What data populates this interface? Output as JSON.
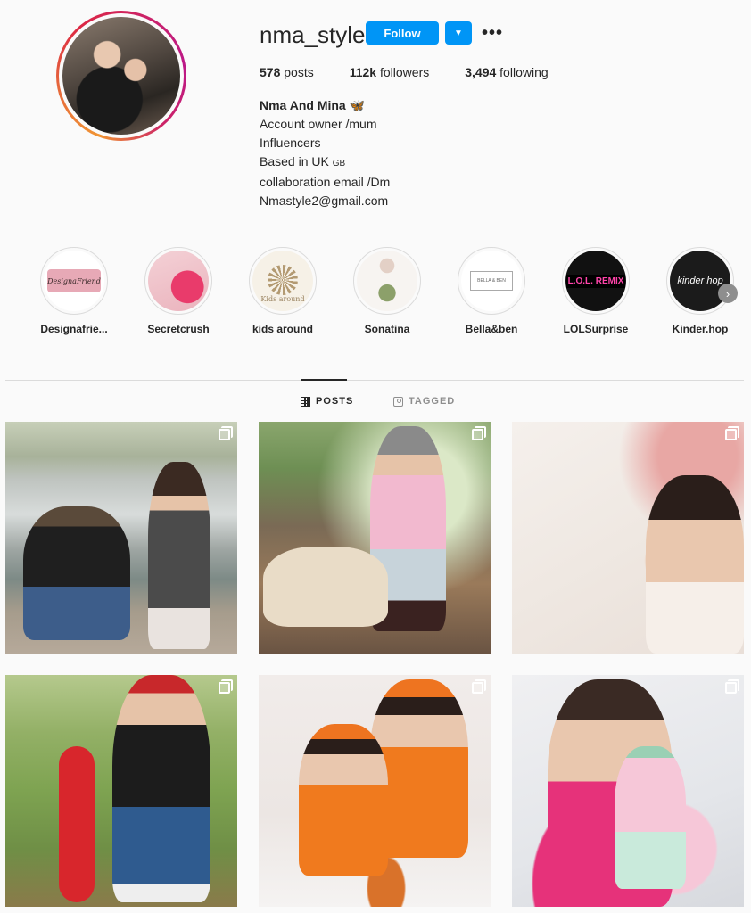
{
  "profile": {
    "username": "nma_style",
    "follow_label": "Follow",
    "posts_count": "578",
    "posts_label": "posts",
    "followers_count": "112k",
    "followers_label": "followers",
    "following_count": "3,494",
    "following_label": "following",
    "bio": {
      "name": "Nma And Mina 🦋",
      "line1": "Account owner /mum",
      "line2": "Influencers",
      "line3": "Based in UK",
      "line3_flag": "GB",
      "line4": "collaboration email /Dm",
      "line5": "Nmastyle2@gmail.com"
    }
  },
  "highlights": [
    {
      "label": "Designafrie...",
      "art": "DesignaFriend"
    },
    {
      "label": "Secretcrush",
      "art": ""
    },
    {
      "label": "kids around",
      "art": "Kids around"
    },
    {
      "label": "Sonatina",
      "art": ""
    },
    {
      "label": "Bella&ben",
      "art": "BELLA & BEN"
    },
    {
      "label": "LOLSurprise",
      "art": "L.O.L. REMIX"
    },
    {
      "label": "Kinder.hop",
      "art": "kinder hop"
    }
  ],
  "tabs": {
    "posts": "POSTS",
    "tagged": "TAGGED"
  },
  "colors": {
    "accent": "#0095f6",
    "background": "#fafafa",
    "text": "#262626",
    "muted": "#8e8e8e"
  }
}
